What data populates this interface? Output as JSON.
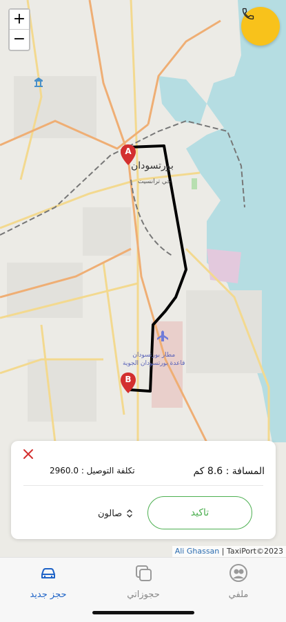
{
  "map": {
    "zoom_in_label": "+",
    "zoom_out_label": "−",
    "city_label": "بورتسودان",
    "district_label": "حي ترانسيت",
    "airport_label_line1": "مطار بورتسودان",
    "airport_label_line2": "قاعدة بورتسودان الجوية",
    "marker_a": "A",
    "marker_b": "B",
    "call_icon": "phone-icon",
    "route_color": "#000000",
    "marker_color": "#d32f2f",
    "attribution_author": "Ali Ghassan",
    "attribution_sep": "|",
    "attribution_brand": "TaxiPort©2023"
  },
  "booking": {
    "close_icon": "close-icon",
    "distance_text": "المسافة : 8.6 كم",
    "cost_text": "تكلفة التوصيل : 2960.0",
    "confirm_label": "تاكيد",
    "car_type": "صالون",
    "accent_color": "#4caf50"
  },
  "nav": {
    "items": [
      {
        "label": "حجز جديد",
        "icon": "car-icon",
        "active": true
      },
      {
        "label": "حجوزاتي",
        "icon": "copy-icon",
        "active": false
      },
      {
        "label": "ملفي",
        "icon": "user-icon",
        "active": false
      }
    ],
    "active_color": "#1e63c7"
  }
}
